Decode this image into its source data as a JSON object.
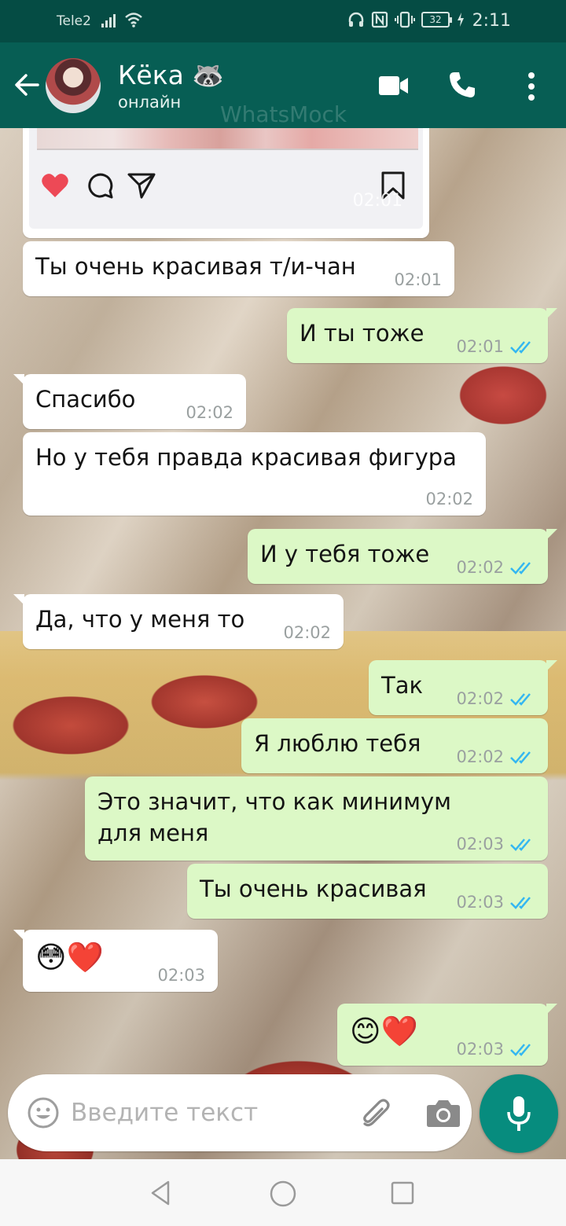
{
  "status_bar": {
    "carrier": "Tele2",
    "battery": "32",
    "time": "2:11"
  },
  "header": {
    "contact_name": "Кёка 🦝",
    "contact_status": "онлайн",
    "watermark": "WhatsMock"
  },
  "post_card": {
    "time": "02:01"
  },
  "messages": [
    {
      "dir": "in",
      "text": "Ты очень красивая т/и-чан",
      "time": "02:01"
    },
    {
      "dir": "out",
      "text": "И ты тоже",
      "time": "02:01",
      "status": "read"
    },
    {
      "dir": "in",
      "text": "Спасибо",
      "time": "02:02"
    },
    {
      "dir": "in",
      "text": "Но у тебя правда красивая фигура",
      "time": "02:02"
    },
    {
      "dir": "out",
      "text": "И у тебя тоже",
      "time": "02:02",
      "status": "read"
    },
    {
      "dir": "in",
      "text": "Да, что у меня то",
      "time": "02:02"
    },
    {
      "dir": "out",
      "text": "Так",
      "time": "02:02",
      "status": "read"
    },
    {
      "dir": "out",
      "text": "Я люблю тебя",
      "time": "02:02",
      "status": "read"
    },
    {
      "dir": "out",
      "text": "Это значит, что как минимум для меня",
      "time": "02:03",
      "status": "read"
    },
    {
      "dir": "out",
      "text": "Ты очень красивая",
      "time": "02:03",
      "status": "read"
    },
    {
      "dir": "in",
      "text": "😳❤️",
      "time": "02:03"
    },
    {
      "dir": "out",
      "text": "😊❤️",
      "time": "02:03",
      "status": "read"
    }
  ],
  "composer": {
    "placeholder": "Введите текст"
  },
  "colors": {
    "status_bar": "#054c44",
    "app_bar": "#075e54",
    "outgoing_bubble": "#dcf8c6",
    "incoming_bubble": "#ffffff",
    "read_ticks": "#34b7f1",
    "mic_button": "#078c7e"
  },
  "icons": [
    "back-arrow-icon",
    "video-call-icon",
    "phone-icon",
    "more-menu-icon",
    "heart-icon",
    "comment-icon",
    "share-icon",
    "bookmark-icon",
    "emoji-icon",
    "attach-icon",
    "camera-icon",
    "mic-icon"
  ]
}
